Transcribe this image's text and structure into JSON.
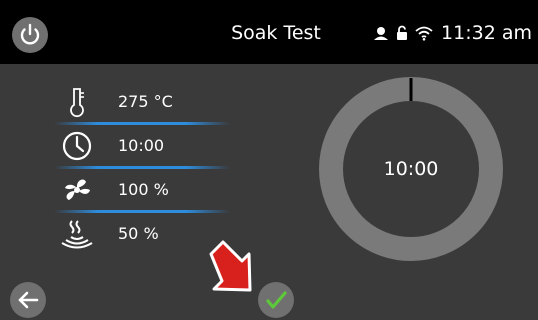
{
  "header": {
    "title": "Soak Test",
    "power_icon": "power-icon",
    "status_icons": [
      "person-icon",
      "lock-icon",
      "wifi-icon"
    ],
    "clock": "11:32 am"
  },
  "params": [
    {
      "icon": "thermometer-icon",
      "value": "275 °C"
    },
    {
      "icon": "clock-icon",
      "value": "10:00"
    },
    {
      "icon": "fan-icon",
      "value": "100 %"
    },
    {
      "icon": "steam-icon",
      "value": "50 %"
    }
  ],
  "timer": {
    "display": "10:00",
    "progress": 0,
    "ring_color": "#7a7a7a",
    "marker_color": "#000000"
  },
  "footer": {
    "back_icon": "arrow-left-icon",
    "confirm_icon": "checkmark-icon",
    "pointer_icon": "red-arrow-pointer-icon"
  },
  "colors": {
    "background": "#3a3a3a",
    "header": "#000000",
    "accent_divider": "#2e8cdc",
    "confirm_check": "#5cc83a",
    "pointer": "#d8201c"
  }
}
